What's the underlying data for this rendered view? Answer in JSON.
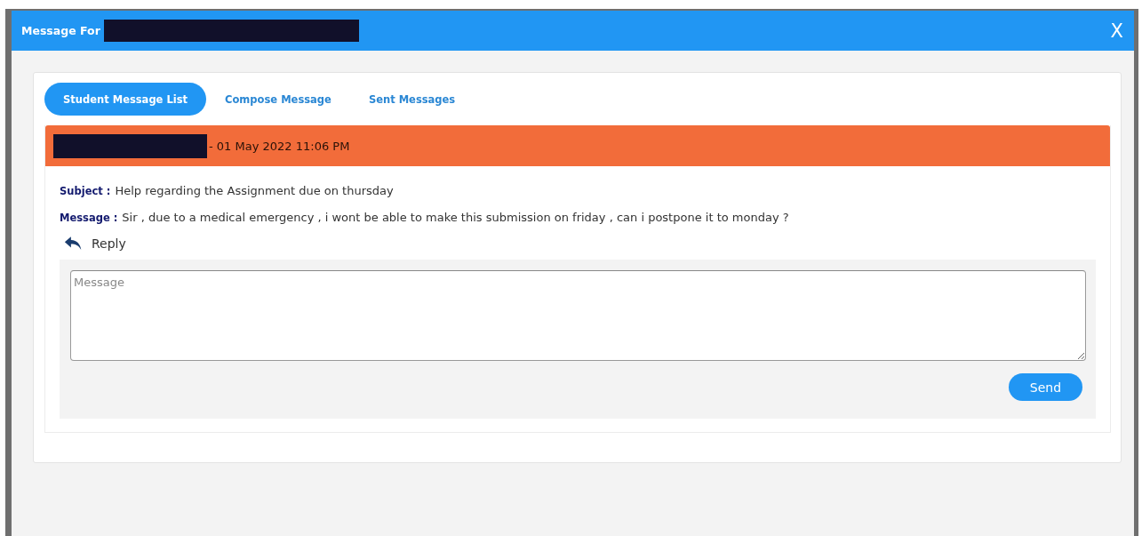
{
  "window": {
    "title": "Message For",
    "title_redacted": true,
    "close": "X"
  },
  "tabs": [
    {
      "label": "Student Message List",
      "selected": true
    },
    {
      "label": "Compose Message",
      "selected": false
    },
    {
      "label": "Sent Messages",
      "selected": false
    }
  ],
  "message": {
    "sender_redacted": true,
    "date": "- 01 May 2022 11:06 PM",
    "subject_label": "Subject :",
    "subject": "Help regarding the Assignment due on thursday",
    "message_label": "Message :",
    "body": "Sir , due to a medical emergency , i wont be able to make this submission on friday , can i postpone it to monday ?"
  },
  "reply": {
    "label": "Reply",
    "placeholder": "Message",
    "send": "Send"
  }
}
